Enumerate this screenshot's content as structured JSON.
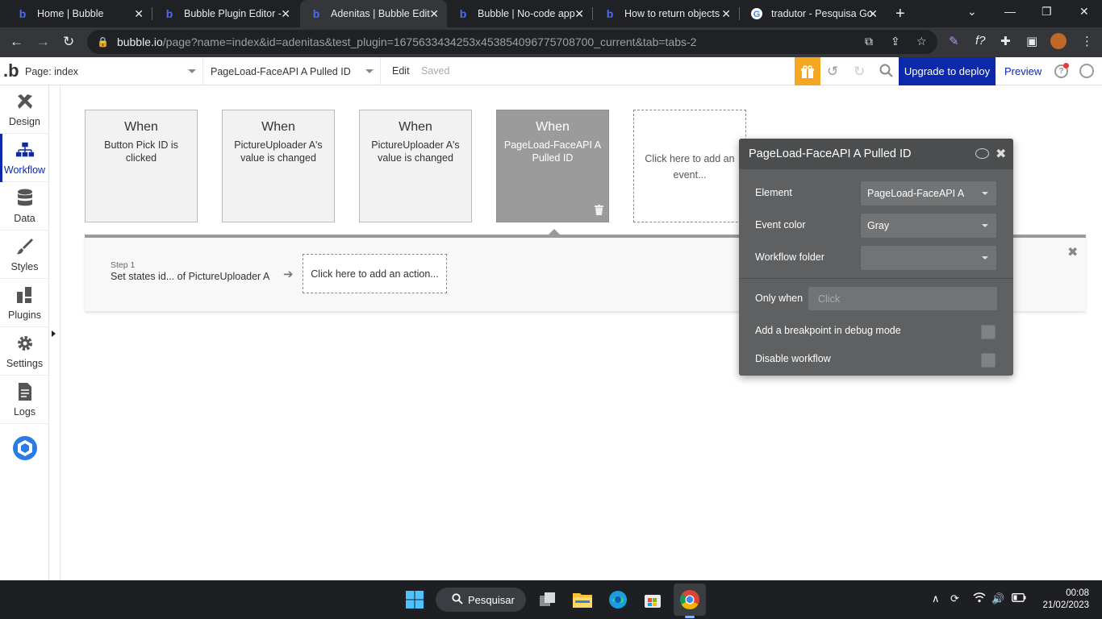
{
  "browser": {
    "tabs": [
      {
        "title": "Home | Bubble"
      },
      {
        "title": "Bubble Plugin Editor -"
      },
      {
        "title": "Adenitas | Bubble Edit"
      },
      {
        "title": "Bubble | No-code app"
      },
      {
        "title": "How to return objects"
      },
      {
        "title": "tradutor - Pesquisa Go"
      }
    ],
    "url_domain": "bubble.io",
    "url_path": "/page?name=index&id=adenitas&test_plugin=1675633434253x453854096775708700_current&tab=tabs-2"
  },
  "topbar": {
    "page_label": "Page: index",
    "workflow_label": "PageLoad-FaceAPI A Pulled ID",
    "edit_label": "Edit",
    "saved_label": "Saved",
    "upgrade_label": "Upgrade to deploy",
    "preview_label": "Preview",
    "help_glyph": "?",
    "logo_glyph": ".b"
  },
  "sidebar": {
    "items": [
      {
        "label": "Design"
      },
      {
        "label": "Workflow"
      },
      {
        "label": "Data"
      },
      {
        "label": "Styles"
      },
      {
        "label": "Plugins"
      },
      {
        "label": "Settings"
      },
      {
        "label": "Logs"
      }
    ]
  },
  "events": [
    {
      "when": "When",
      "desc": "Button Pick ID is clicked"
    },
    {
      "when": "When",
      "desc": "PictureUploader A's value is changed"
    },
    {
      "when": "When",
      "desc": "PictureUploader A's value is changed"
    },
    {
      "when": "When",
      "desc": "PageLoad-FaceAPI A Pulled ID"
    }
  ],
  "add_event_label": "Click here to add an event...",
  "steps": {
    "step_label": "Step 1",
    "step_desc": "Set states id... of PictureUploader A",
    "add_action_label": "Click here to add an action..."
  },
  "property_editor": {
    "title": "PageLoad-FaceAPI A Pulled ID",
    "element_label": "Element",
    "element_value": "PageLoad-FaceAPI A",
    "event_color_label": "Event color",
    "event_color_value": "Gray",
    "folder_label": "Workflow folder",
    "folder_value": "",
    "only_when_label": "Only when",
    "only_when_placeholder": "Click",
    "breakpoint_label": "Add a breakpoint in debug mode",
    "disable_label": "Disable workflow"
  },
  "taskbar": {
    "search_label": "Pesquisar",
    "time": "00:08",
    "date": "21/02/2023"
  },
  "colors": {
    "bubble_blue": "#0c29ab",
    "gift_orange": "#f5a623",
    "selected_card": "#9b9b9b",
    "editor_bg": "#5e6062"
  }
}
